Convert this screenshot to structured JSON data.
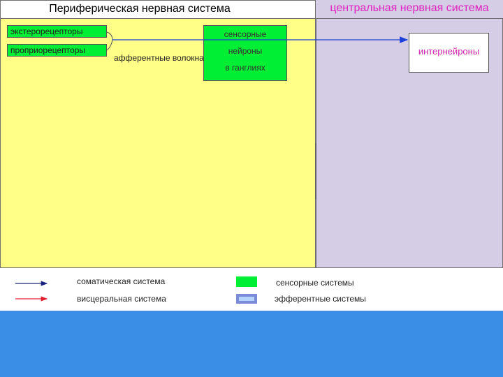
{
  "peripheral": {
    "title": "Периферическая нервная система",
    "exteroceptors": "экстерорецепторы",
    "proprioceptors": "проприорецепторы",
    "sensory_neurons": [
      "сенсорные",
      "нейроны",
      "в ганглиях"
    ],
    "afferent_fibers": "афферентные волокна"
  },
  "central": {
    "title": "центральная нервная система",
    "interneurons": "интернейроны"
  },
  "legend": {
    "somatic": "соматическая система",
    "visceral": "висцеральная система",
    "sensory_systems": "сенсорные системы",
    "effector_systems": "эфферентные системы"
  },
  "colors": {
    "peripheral_bg": "#ffff88",
    "central_bg": "#d5cde5",
    "sensory_green": "#00ee33",
    "somatic_arrow": "#1a237e",
    "visceral_arrow": "#e02030",
    "central_title": "#e020c0",
    "bottom_band": "#3a8ee6"
  }
}
